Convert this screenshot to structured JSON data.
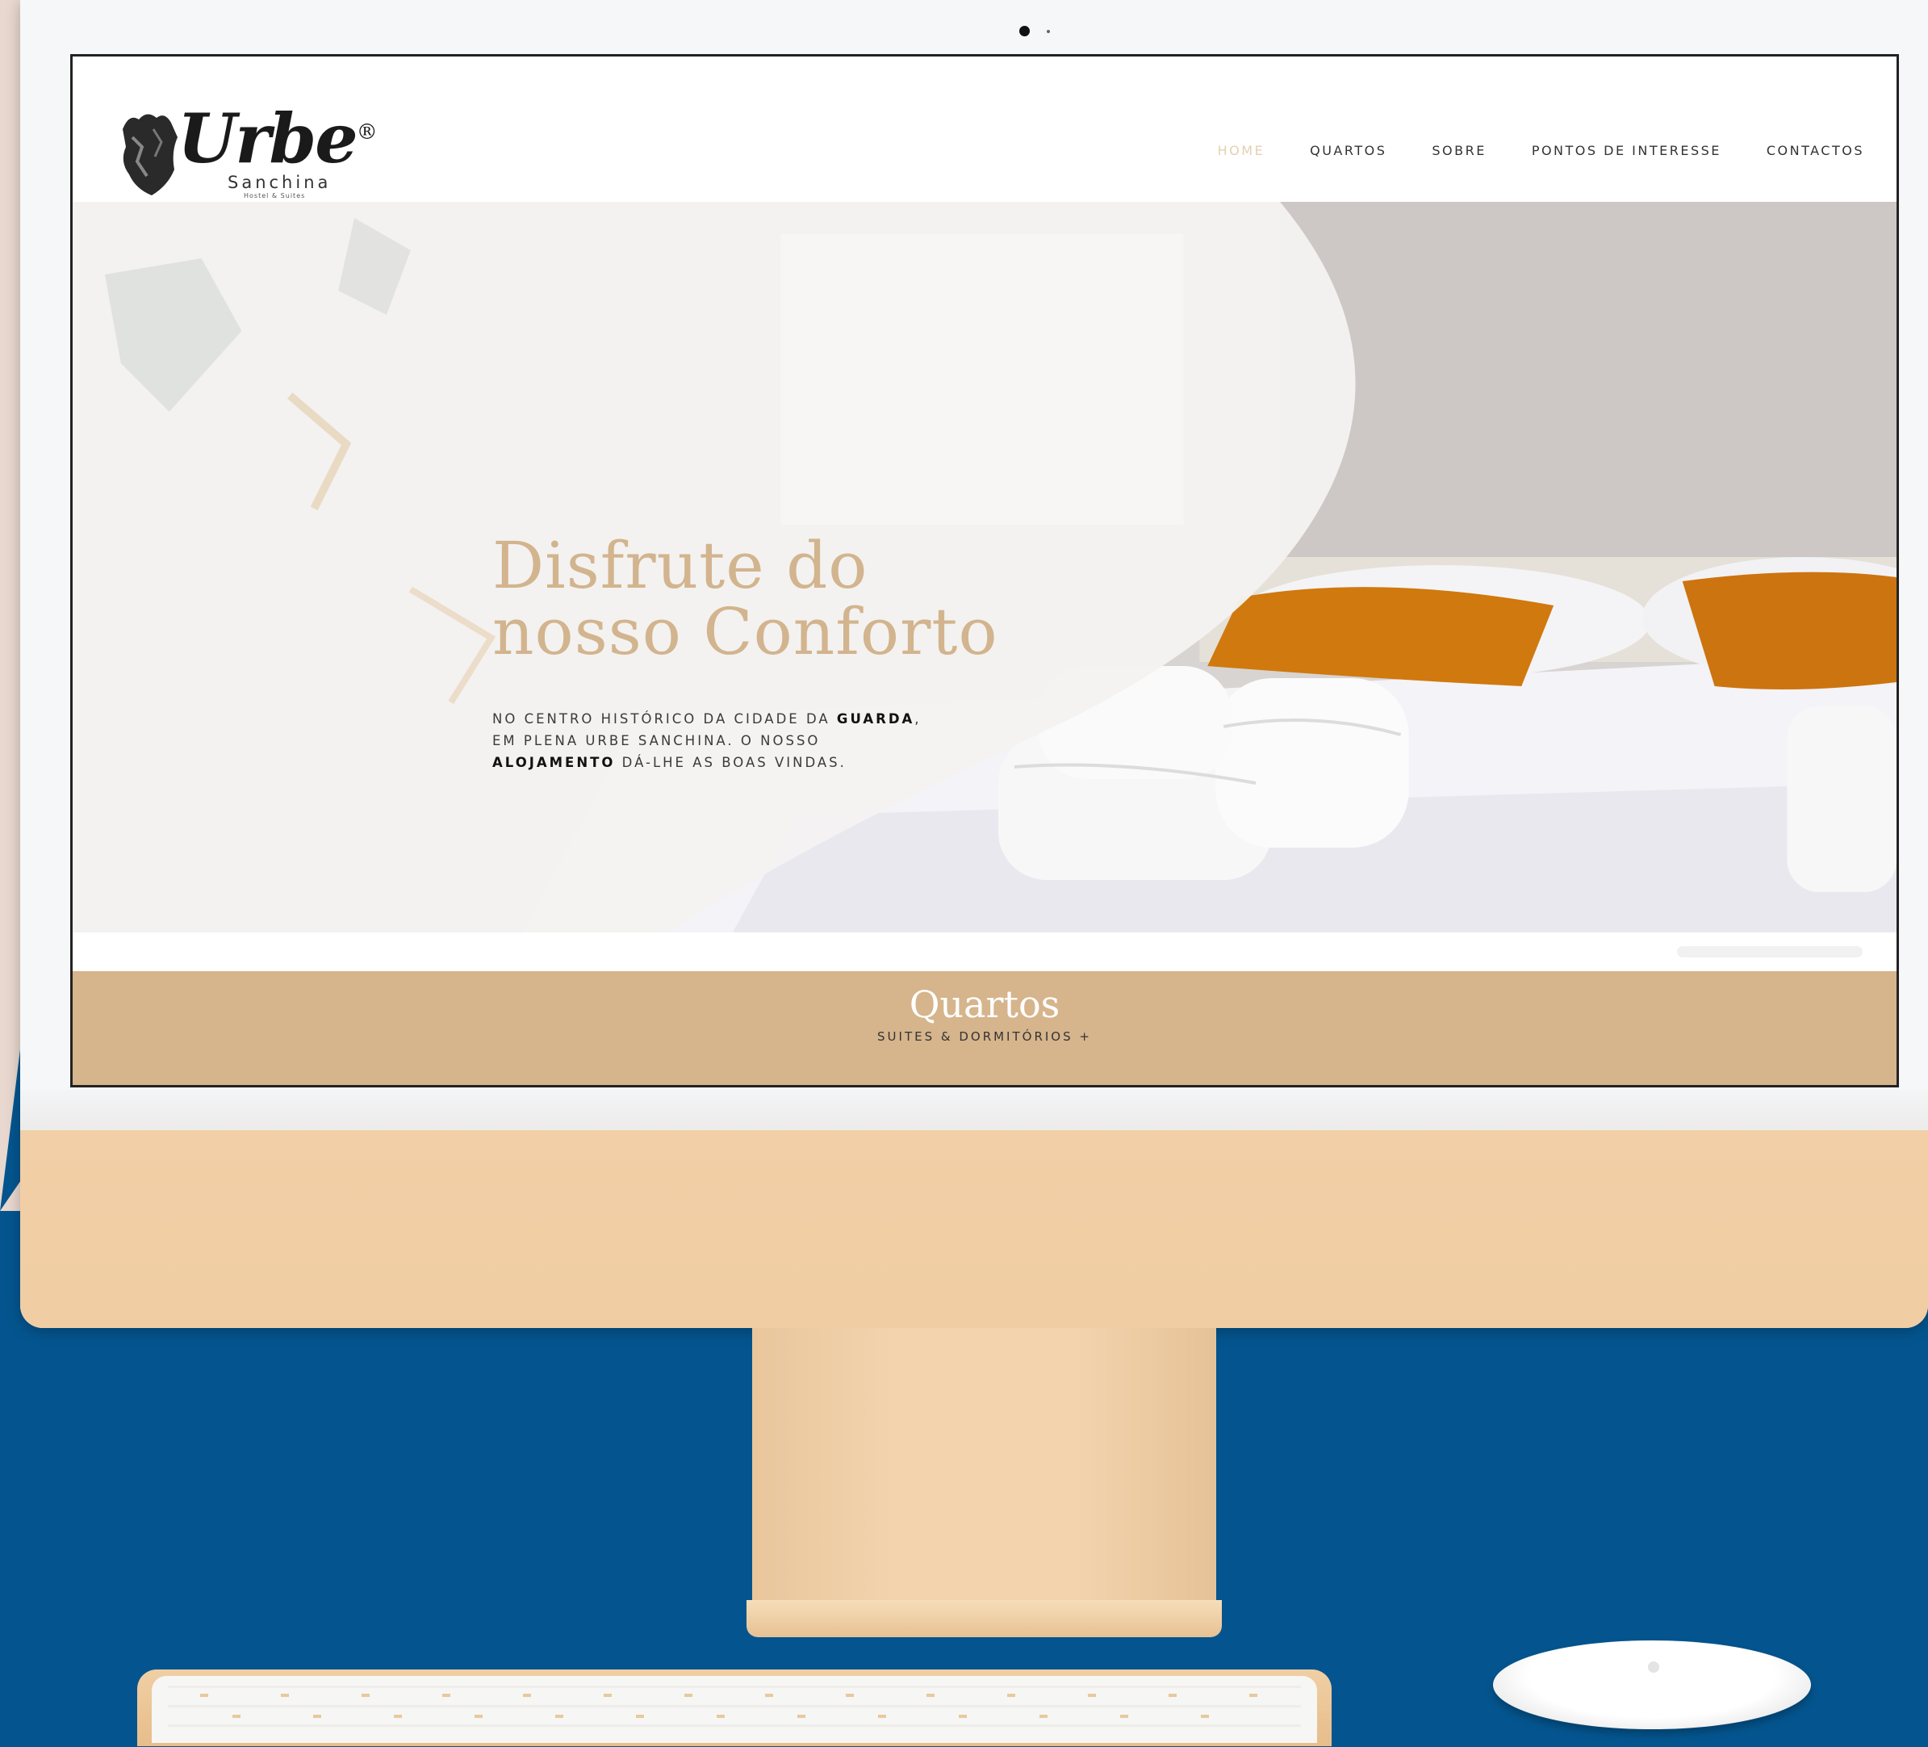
{
  "site": {
    "logo": {
      "word": "Urbe",
      "registered": "®",
      "sub": "Sanchina",
      "tagline": "Hostel & Suites"
    },
    "nav": {
      "items": [
        {
          "label": "HOME",
          "active": true
        },
        {
          "label": "QUARTOS",
          "active": false
        },
        {
          "label": "SOBRE",
          "active": false
        },
        {
          "label": "PONTOS DE INTERESSE",
          "active": false
        },
        {
          "label": "CONTACTOS",
          "active": false
        }
      ]
    },
    "hero": {
      "title_line1": "Disfrute do",
      "title_line2": "nosso Conforto",
      "text_part1": "NO CENTRO HISTÓRICO DA CIDADE DA ",
      "text_bold1": "GUARDA",
      "text_part2": ", EM PLENA URBE SANCHINA. O NOSSO ",
      "text_bold2": "ALOJAMENTO",
      "text_part3": " DÁ-LHE AS BOAS VINDAS."
    },
    "section": {
      "title": "Quartos",
      "subtitle": "SUITES & DORMITÓRIOS +"
    }
  },
  "colors": {
    "page_background": "#04558f",
    "device_gold": "#f0cda3",
    "accent_tan": "#d6b48c",
    "title_tan": "#d2b48e",
    "pillow_orange": "#d0790e"
  }
}
